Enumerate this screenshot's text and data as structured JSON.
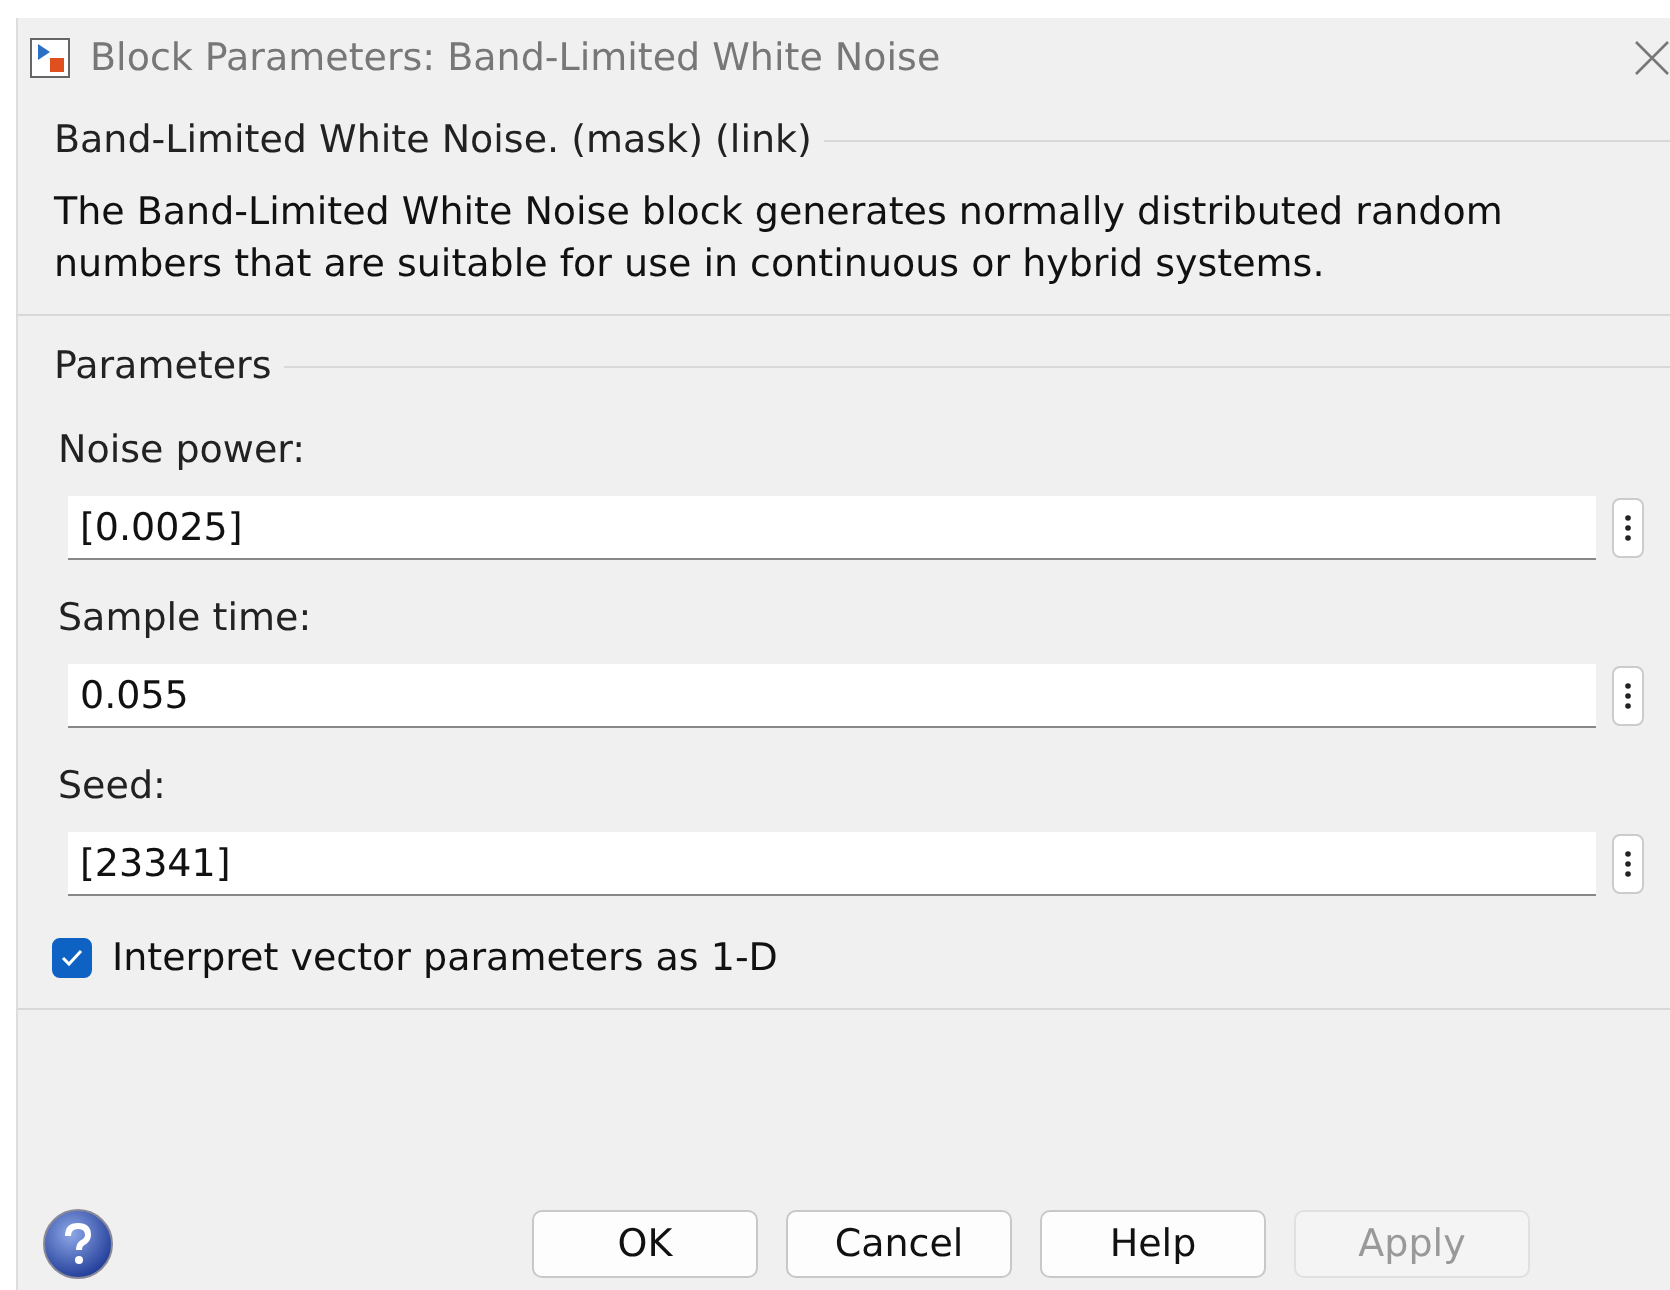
{
  "window": {
    "title": "Block Parameters: Band-Limited White Noise"
  },
  "description_group": {
    "title": "Band-Limited White Noise. (mask) (link)",
    "text": "The Band-Limited White Noise block generates normally distributed random numbers that are suitable for use in continuous or hybrid systems."
  },
  "parameters": {
    "title": "Parameters",
    "fields": [
      {
        "label": "Noise power:",
        "value": "[0.0025]"
      },
      {
        "label": "Sample time:",
        "value": "0.055"
      },
      {
        "label": "Seed:",
        "value": "[23341]"
      }
    ],
    "checkbox": {
      "label": "Interpret vector parameters as 1-D",
      "checked": true
    }
  },
  "buttons": [
    {
      "label": "OK",
      "disabled": false
    },
    {
      "label": "Cancel",
      "disabled": false
    },
    {
      "label": "Help",
      "disabled": false
    },
    {
      "label": "Apply",
      "disabled": true
    }
  ]
}
